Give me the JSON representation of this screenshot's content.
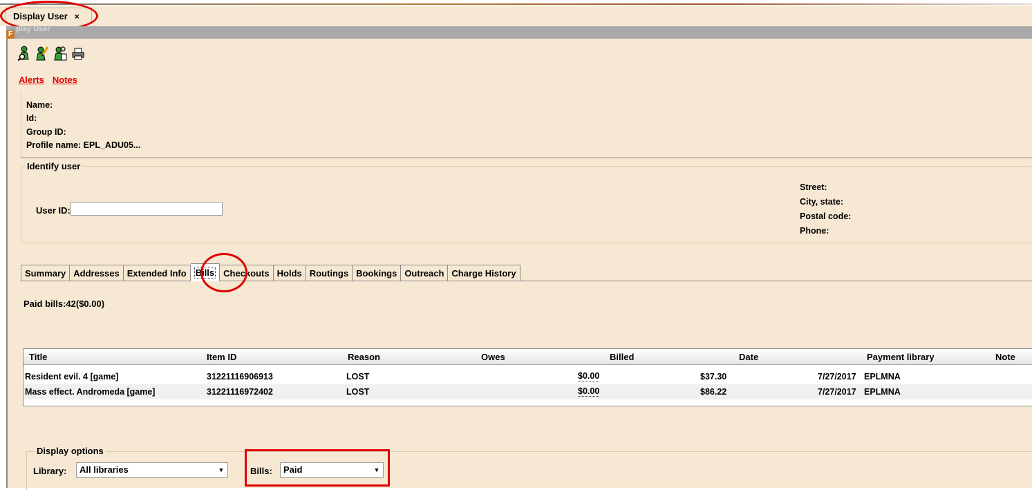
{
  "window": {
    "tab_label": "Display User",
    "tab_close": "×",
    "panel_title": "play User",
    "panel_icon": "F"
  },
  "toolbar": {
    "icons": [
      "user-search-icon",
      "user-edit-icon",
      "user-lookup-icon",
      "print-icon"
    ]
  },
  "links": {
    "alerts": "Alerts",
    "notes": "Notes"
  },
  "user_info": {
    "name_label": "Name:",
    "id_label": "Id:",
    "group_label": "Group ID:",
    "profile_label": "Profile name: EPL_ADU05..."
  },
  "identify": {
    "legend": "Identify user",
    "user_id_label": "User ID:",
    "user_id_value": "",
    "street": "Street:",
    "city": "City, state:",
    "postal": "Postal code:",
    "phone": "Phone:"
  },
  "tabs": [
    "Summary",
    "Addresses",
    "Extended Info",
    "Bills",
    "Checkouts",
    "Holds",
    "Routings",
    "Bookings",
    "Outreach",
    "Charge History"
  ],
  "active_tab": "Bills",
  "bills": {
    "summary": "Paid bills:42($0.00)",
    "columns": [
      "Title",
      "Item ID",
      "Reason",
      "Owes",
      "Billed",
      "Date",
      "Payment library",
      "Note"
    ],
    "rows": [
      [
        "Resident evil. 4 [game]",
        "31221116906913",
        "LOST",
        "$0.00",
        "$37.30",
        "7/27/2017",
        "EPLMNA",
        ""
      ],
      [
        "Mass effect. Andromeda [game]",
        "31221116972402",
        "LOST",
        "$0.00",
        "$86.22",
        "7/27/2017",
        "EPLMNA",
        ""
      ]
    ]
  },
  "display_options": {
    "legend": "Display options",
    "library_label": "Library:",
    "library_value": "All libraries",
    "bills_label": "Bills:",
    "bills_value": "Paid"
  },
  "colors": {
    "background": "#f6e8d3",
    "highlight": "#e00000",
    "link": "#e00000"
  }
}
